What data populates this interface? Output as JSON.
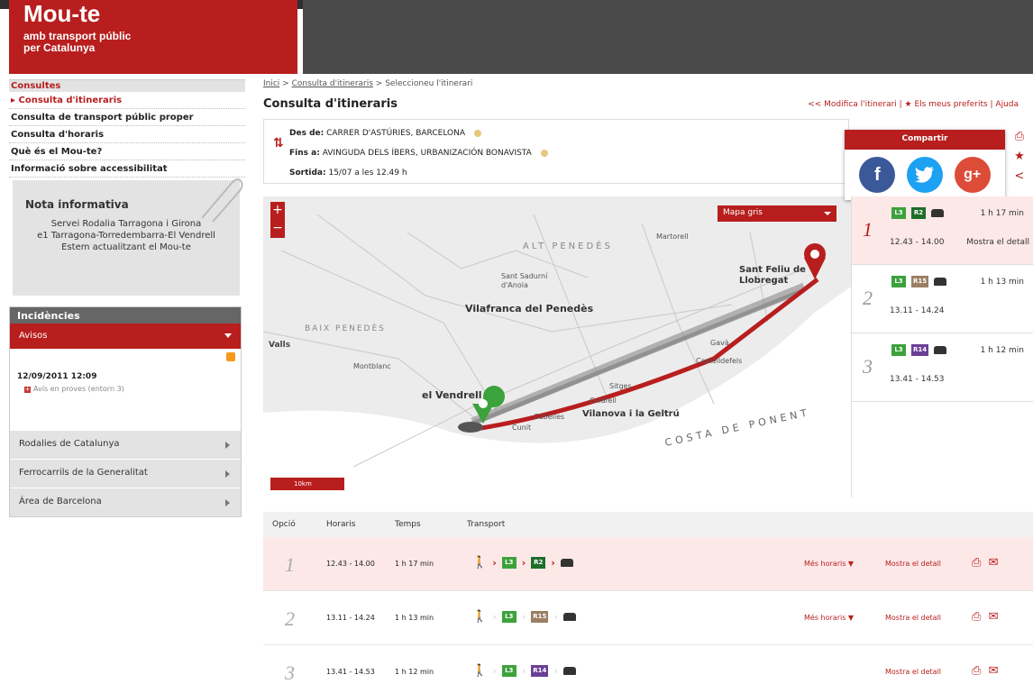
{
  "header": {
    "brand": "Mou-te",
    "tagline_1": "amb transport públic",
    "tagline_2": "per Catalunya"
  },
  "sidebar": {
    "section_title": "Consultes",
    "items": [
      {
        "label": "▸ Consulta d'itineraris",
        "active": true
      },
      {
        "label": "Consulta de transport públic proper"
      },
      {
        "label": "Consulta d'horaris"
      },
      {
        "label": "Què és el Mou-te?"
      },
      {
        "label": "Informació sobre accessibilitat"
      }
    ],
    "nota": {
      "title": "Nota informativa",
      "lines": [
        "Servei Rodalia Tarragona i Girona",
        "e1 Tarragona-Torredembarra-El Vendrell",
        "Estem actualitzant el Mou-te"
      ]
    },
    "incidencies": {
      "title": "Incidències",
      "avisos": "Avisos",
      "date": "12/09/2011 12:09",
      "avis": "Avís en proves (entorn 3)",
      "sections": [
        "Rodalies de Catalunya",
        "Ferrocarrils de la Generalitat",
        "Àrea de Barcelona"
      ]
    }
  },
  "breadcrumb": {
    "home": "Inici",
    "sep": " > ",
    "level2": "Consulta d'itineraris",
    "current": "Seleccioneu l'itinerari"
  },
  "page_title": "Consulta d'itineraris",
  "top_links": "<< Modifica l'itinerari | ★ Els meus preferits | Ajuda",
  "route": {
    "from_label": "Des de:",
    "from_value": "CARRER D'ASTÚRIES, BARCELONA",
    "to_label": "Fins a:",
    "to_value": "AVINGUDA DELS ÍBERS, URBANIZACIÓN BONAVISTA",
    "departure_label": "Sortida:",
    "departure_value": "15/07 a les 12.49 h"
  },
  "share": {
    "title": "Compartir",
    "facebook": "f",
    "google": "g+"
  },
  "map": {
    "map_type": "Mapa gris",
    "scale": "10km",
    "labels": [
      "Vilafranca del Penedès",
      "el Vendrell",
      "Vilanova i la Geltrú",
      "Sant Feliu de Llobregat",
      "COSTA DE PONENT",
      "BAIX PENEDÈS",
      "Calafell",
      "Cubelles",
      "Cunit",
      "Sant Sadurní d'Anoia",
      "Valls",
      "Montblanc",
      "Gavà",
      "Castelldefels",
      "Sitges",
      "ALT PENEDÈS",
      "Martorell"
    ],
    "colors": {
      "route": "#b81e1e",
      "origin_pin": "#3ca23c",
      "dest_pin": "#b81e1e",
      "alt_route": "#8a8a8a"
    }
  },
  "options_panel": [
    {
      "num": "1",
      "lines": [
        "L3",
        "R2"
      ],
      "duration": "1 h 17 min",
      "times": "12.43 - 14.00",
      "detail": "Mostra el detall",
      "selected": true
    },
    {
      "num": "2",
      "lines": [
        "L3",
        "R15"
      ],
      "duration": "1 h 13 min",
      "times": "13.11 - 14.24",
      "detail": "",
      "selected": false
    },
    {
      "num": "3",
      "lines": [
        "L3",
        "R14"
      ],
      "duration": "1 h 12 min",
      "times": "13.41 - 14.53",
      "detail": "",
      "selected": false
    }
  ],
  "table": {
    "headers": {
      "opcio": "Opció",
      "horaris": "Horaris",
      "temps": "Temps",
      "transport": "Transport"
    },
    "rows": [
      {
        "num": "1",
        "horaris": "12.43 - 14.00",
        "temps": "1 h 17 min",
        "lines": [
          "L3",
          "R2"
        ],
        "mes_horaris": "Més horaris ▼",
        "detall": "Mostra el detall",
        "selected": true
      },
      {
        "num": "2",
        "horaris": "13.11 - 14.24",
        "temps": "1 h 13 min",
        "lines": [
          "L3",
          "R15"
        ],
        "mes_horaris": "Més horaris ▼",
        "detall": "Mostra el detall",
        "selected": false
      },
      {
        "num": "3",
        "horaris": "13.41 - 14.53",
        "temps": "1 h 12 min",
        "lines": [
          "L3",
          "R14"
        ],
        "mes_horaris": "",
        "detall": "Mostra el detall",
        "selected": false
      }
    ]
  },
  "line_colors": {
    "L3": "#3ca23c",
    "R2": "#1d6e2a",
    "R15": "#9b7e64",
    "R14": "#6a3f96"
  }
}
